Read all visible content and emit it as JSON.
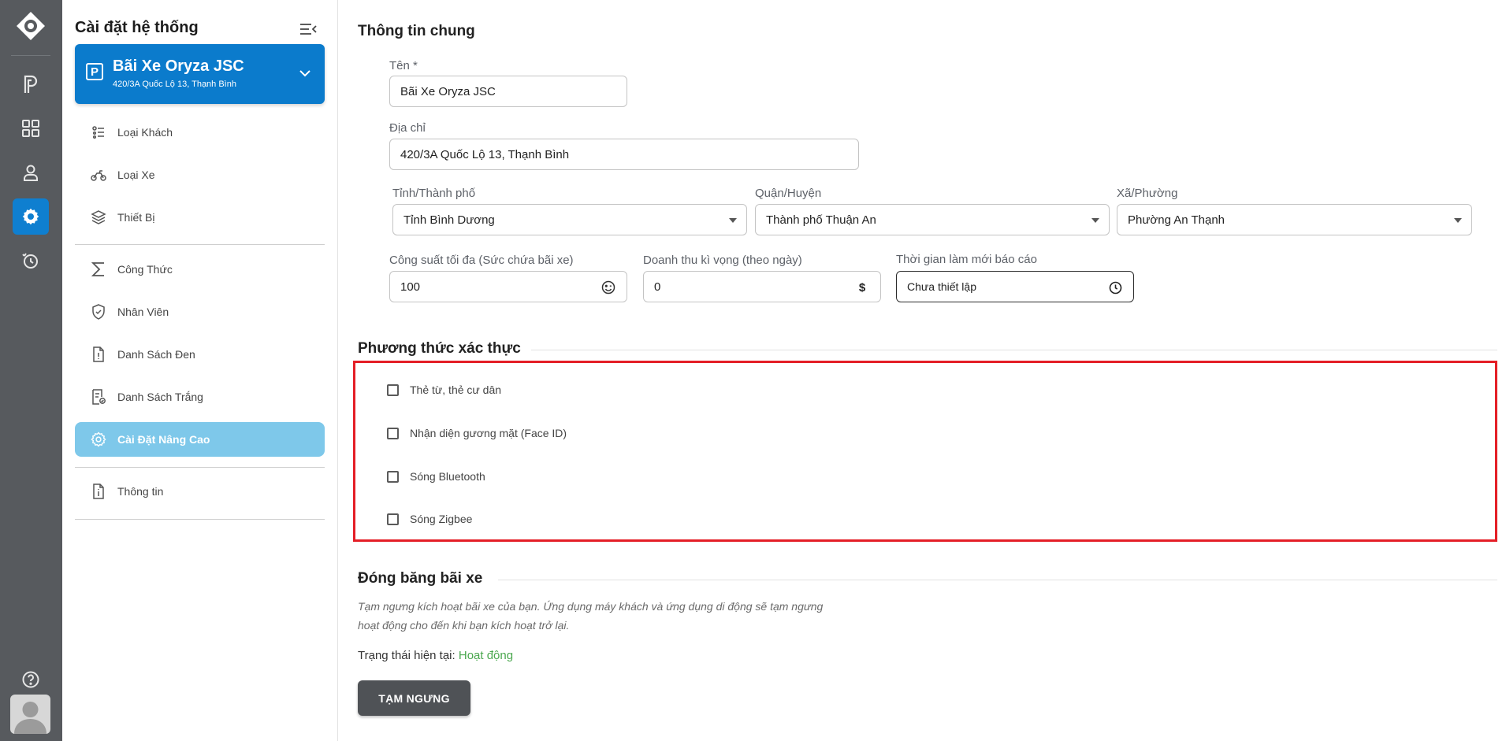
{
  "sidebar": {
    "title": "Cài đặt hệ thống",
    "site": {
      "name": "Bãi Xe Oryza JSC",
      "address": "420/3A Quốc Lộ 13, Thạnh Bình",
      "badge": "P"
    },
    "items": [
      {
        "label": "Loại Khách",
        "icon": "customer-type-icon"
      },
      {
        "label": "Loại Xe",
        "icon": "motorbike-icon"
      },
      {
        "label": "Thiết Bị",
        "icon": "layers-icon"
      },
      {
        "label": "Công Thức",
        "icon": "sigma-icon"
      },
      {
        "label": "Nhân Viên",
        "icon": "shield-check-icon"
      },
      {
        "label": "Danh Sách Đen",
        "icon": "document-alert-icon"
      },
      {
        "label": "Danh Sách Trắng",
        "icon": "document-check-icon"
      },
      {
        "label": "Cài Đặt Nâng Cao",
        "icon": "gear-icon",
        "active": true
      },
      {
        "label": "Thông tin",
        "icon": "document-info-icon"
      }
    ]
  },
  "rail": {
    "items": [
      "parking-icon",
      "grid-icon",
      "user-icon",
      "settings-icon",
      "history-icon"
    ],
    "help_icon": "help-icon",
    "active": "settings-icon"
  },
  "general": {
    "title": "Thông tin chung",
    "name_label": "Tên *",
    "name_value": "Bãi Xe Oryza JSC",
    "address_label": "Địa chỉ",
    "address_value": "420/3A Quốc Lộ 13, Thạnh Bình",
    "province_label": "Tỉnh/Thành phố",
    "province_value": "Tỉnh Bình Dương",
    "district_label": "Quận/Huyện",
    "district_value": "Thành phố Thuận An",
    "ward_label": "Xã/Phường",
    "ward_value": "Phường An Thạnh",
    "capacity_label": "Công suất tối đa (Sức chứa bãi xe)",
    "capacity_value": "100",
    "revenue_label": "Doanh thu kì vọng (theo ngày)",
    "revenue_value": "0",
    "refresh_label": "Thời gian làm mới báo cáo",
    "refresh_value": "Chưa thiết lập"
  },
  "auth": {
    "title": "Phương thức xác thực",
    "options": [
      {
        "label": "Thẻ từ, thẻ cư dân",
        "checked": false
      },
      {
        "label": "Nhận diện gương mặt (Face ID)",
        "checked": false
      },
      {
        "label": "Sóng Bluetooth",
        "checked": false
      },
      {
        "label": "Sóng Zigbee",
        "checked": false
      }
    ]
  },
  "freeze": {
    "title": "Đóng băng bãi xe",
    "description": "Tạm ngưng kích hoạt bãi xe của bạn. Ứng dụng máy khách và ứng dụng di động sẽ tạm ngưng hoạt động cho đến khi bạn kích hoạt trở lại.",
    "status_label": "Trạng thái hiện tại:",
    "status_value": "Hoạt động",
    "button_label": "TẠM NGƯNG"
  },
  "colors": {
    "accent": "#0b7bcc",
    "active_menu": "#7ec8ea",
    "rail": "#575a5e",
    "highlight_border": "#e41e26",
    "status_ok": "#4aa74e"
  }
}
